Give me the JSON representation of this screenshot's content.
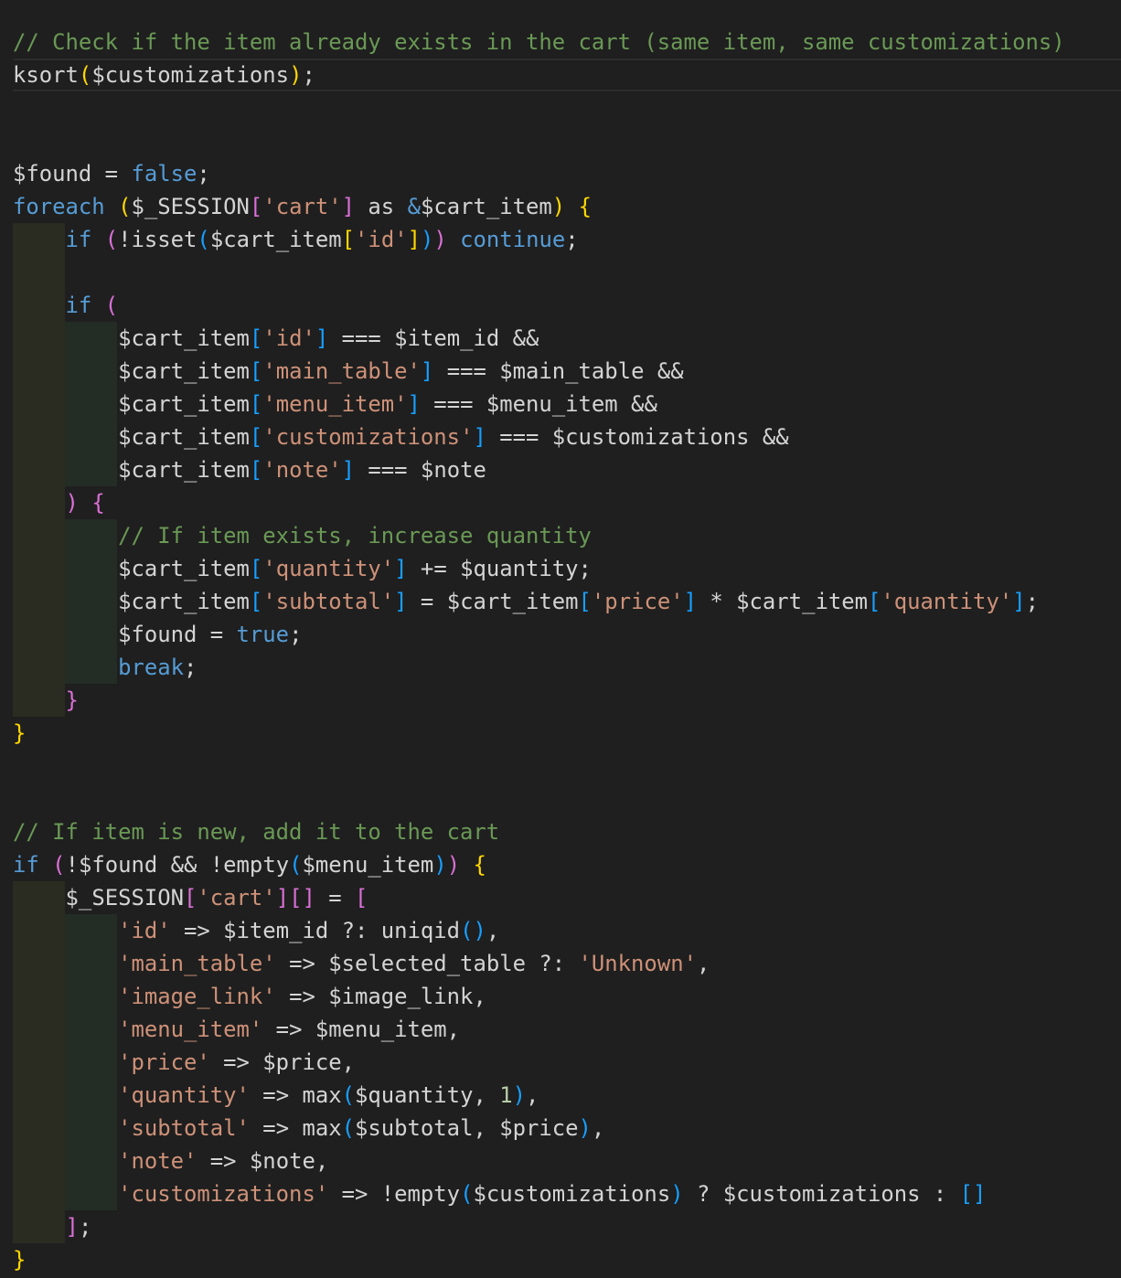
{
  "editor": {
    "language": "php",
    "colors": {
      "background": "#1f1f1f",
      "text": "#d4d4d4",
      "comment": "#6a9955",
      "keyword": "#569cd6",
      "string": "#ce9178",
      "number": "#b5cea8",
      "bracket_level_1": "#ffd700",
      "bracket_level_2": "#da70d6",
      "bracket_level_3": "#179fff"
    },
    "lines": [
      {
        "indent": 0,
        "tokens": [
          [
            "cm",
            "// Check if the item already exists in the cart (same item, same customizations)"
          ]
        ]
      },
      {
        "indent": 0,
        "current": true,
        "tokens": [
          [
            "",
            "ksort"
          ],
          [
            "b1",
            "("
          ],
          [
            "",
            "$customizations"
          ],
          [
            "b1",
            ")"
          ],
          [
            "",
            ";"
          ]
        ]
      },
      {
        "indent": 0,
        "tokens": []
      },
      {
        "indent": 0,
        "tokens": []
      },
      {
        "indent": 0,
        "tokens": [
          [
            "",
            "$found = "
          ],
          [
            "kw",
            "false"
          ],
          [
            "",
            ";"
          ]
        ]
      },
      {
        "indent": 0,
        "tokens": [
          [
            "kw",
            "foreach"
          ],
          [
            "",
            " "
          ],
          [
            "b1",
            "("
          ],
          [
            "",
            "$_SESSION"
          ],
          [
            "b2",
            "["
          ],
          [
            "str",
            "'cart'"
          ],
          [
            "b2",
            "]"
          ],
          [
            "",
            " as "
          ],
          [
            "kw",
            "&"
          ],
          [
            "",
            "$cart_item"
          ],
          [
            "b1",
            ")"
          ],
          [
            "",
            " "
          ],
          [
            "b1",
            "{"
          ]
        ]
      },
      {
        "indent": 1,
        "tokens": [
          [
            "kw",
            "if"
          ],
          [
            "",
            " "
          ],
          [
            "b2",
            "("
          ],
          [
            "",
            "!isset"
          ],
          [
            "b3",
            "("
          ],
          [
            "",
            "$cart_item"
          ],
          [
            "b1",
            "["
          ],
          [
            "str",
            "'id'"
          ],
          [
            "b1",
            "]"
          ],
          [
            "b3",
            ")"
          ],
          [
            "b2",
            ")"
          ],
          [
            "",
            " "
          ],
          [
            "kw",
            "continue"
          ],
          [
            "",
            ";"
          ]
        ]
      },
      {
        "indent": 1,
        "blank_guides": true,
        "tokens": []
      },
      {
        "indent": 1,
        "tokens": [
          [
            "kw",
            "if"
          ],
          [
            "",
            " "
          ],
          [
            "b2",
            "("
          ]
        ]
      },
      {
        "indent": 2,
        "tokens": [
          [
            "",
            "$cart_item"
          ],
          [
            "b3",
            "["
          ],
          [
            "str",
            "'id'"
          ],
          [
            "b3",
            "]"
          ],
          [
            "",
            " === $item_id &&"
          ]
        ]
      },
      {
        "indent": 2,
        "tokens": [
          [
            "",
            "$cart_item"
          ],
          [
            "b3",
            "["
          ],
          [
            "str",
            "'main_table'"
          ],
          [
            "b3",
            "]"
          ],
          [
            "",
            " === $main_table &&"
          ]
        ]
      },
      {
        "indent": 2,
        "tokens": [
          [
            "",
            "$cart_item"
          ],
          [
            "b3",
            "["
          ],
          [
            "str",
            "'menu_item'"
          ],
          [
            "b3",
            "]"
          ],
          [
            "",
            " === $menu_item &&"
          ]
        ]
      },
      {
        "indent": 2,
        "tokens": [
          [
            "",
            "$cart_item"
          ],
          [
            "b3",
            "["
          ],
          [
            "str",
            "'customizations'"
          ],
          [
            "b3",
            "]"
          ],
          [
            "",
            " === $customizations &&"
          ]
        ]
      },
      {
        "indent": 2,
        "tokens": [
          [
            "",
            "$cart_item"
          ],
          [
            "b3",
            "["
          ],
          [
            "str",
            "'note'"
          ],
          [
            "b3",
            "]"
          ],
          [
            "",
            " === $note"
          ]
        ]
      },
      {
        "indent": 1,
        "tokens": [
          [
            "b2",
            ")"
          ],
          [
            "",
            " "
          ],
          [
            "b2",
            "{"
          ]
        ]
      },
      {
        "indent": 2,
        "tokens": [
          [
            "cm",
            "// If item exists, increase quantity"
          ]
        ]
      },
      {
        "indent": 2,
        "tokens": [
          [
            "",
            "$cart_item"
          ],
          [
            "b3",
            "["
          ],
          [
            "str",
            "'quantity'"
          ],
          [
            "b3",
            "]"
          ],
          [
            "",
            " += $quantity;"
          ]
        ]
      },
      {
        "indent": 2,
        "tokens": [
          [
            "",
            "$cart_item"
          ],
          [
            "b3",
            "["
          ],
          [
            "str",
            "'subtotal'"
          ],
          [
            "b3",
            "]"
          ],
          [
            "",
            " = $cart_item"
          ],
          [
            "b3",
            "["
          ],
          [
            "str",
            "'price'"
          ],
          [
            "b3",
            "]"
          ],
          [
            "",
            " * $cart_item"
          ],
          [
            "b3",
            "["
          ],
          [
            "str",
            "'quantity'"
          ],
          [
            "b3",
            "]"
          ],
          [
            "",
            ";"
          ]
        ]
      },
      {
        "indent": 2,
        "tokens": [
          [
            "",
            "$found = "
          ],
          [
            "kw",
            "true"
          ],
          [
            "",
            ";"
          ]
        ]
      },
      {
        "indent": 2,
        "tokens": [
          [
            "kw",
            "break"
          ],
          [
            "",
            ";"
          ]
        ]
      },
      {
        "indent": 1,
        "tokens": [
          [
            "b2",
            "}"
          ]
        ]
      },
      {
        "indent": 0,
        "tokens": [
          [
            "b1",
            "}"
          ]
        ]
      },
      {
        "indent": 0,
        "tokens": []
      },
      {
        "indent": 0,
        "tokens": []
      },
      {
        "indent": 0,
        "tokens": [
          [
            "cm",
            "// If item is new, add it to the cart"
          ]
        ]
      },
      {
        "indent": 0,
        "tokens": [
          [
            "kw",
            "if"
          ],
          [
            "",
            " "
          ],
          [
            "b2",
            "("
          ],
          [
            "",
            "!$found && !empty"
          ],
          [
            "b3",
            "("
          ],
          [
            "",
            "$menu_item"
          ],
          [
            "b3",
            ")"
          ],
          [
            "b2",
            ")"
          ],
          [
            "",
            " "
          ],
          [
            "b1",
            "{"
          ]
        ]
      },
      {
        "indent": 1,
        "tokens": [
          [
            "",
            "$_SESSION"
          ],
          [
            "b2",
            "["
          ],
          [
            "str",
            "'cart'"
          ],
          [
            "b2",
            "]["
          ],
          [
            "b2",
            "]"
          ],
          [
            "",
            " = "
          ],
          [
            "b2",
            "["
          ]
        ]
      },
      {
        "indent": 2,
        "tokens": [
          [
            "str",
            "'id'"
          ],
          [
            "",
            " => $item_id ?: uniqid"
          ],
          [
            "b3",
            "()"
          ],
          [
            "",
            ","
          ]
        ]
      },
      {
        "indent": 2,
        "tokens": [
          [
            "str",
            "'main_table'"
          ],
          [
            "",
            " => $selected_table ?: "
          ],
          [
            "str",
            "'Unknown'"
          ],
          [
            "",
            ","
          ]
        ]
      },
      {
        "indent": 2,
        "tokens": [
          [
            "str",
            "'image_link'"
          ],
          [
            "",
            " => $image_link,"
          ]
        ]
      },
      {
        "indent": 2,
        "tokens": [
          [
            "str",
            "'menu_item'"
          ],
          [
            "",
            " => $menu_item,"
          ]
        ]
      },
      {
        "indent": 2,
        "tokens": [
          [
            "str",
            "'price'"
          ],
          [
            "",
            " => $price,"
          ]
        ]
      },
      {
        "indent": 2,
        "tokens": [
          [
            "str",
            "'quantity'"
          ],
          [
            "",
            " => max"
          ],
          [
            "b3",
            "("
          ],
          [
            "",
            "$quantity, "
          ],
          [
            "num",
            "1"
          ],
          [
            "b3",
            ")"
          ],
          [
            "",
            ","
          ]
        ]
      },
      {
        "indent": 2,
        "tokens": [
          [
            "str",
            "'subtotal'"
          ],
          [
            "",
            " => max"
          ],
          [
            "b3",
            "("
          ],
          [
            "",
            "$subtotal, $price"
          ],
          [
            "b3",
            ")"
          ],
          [
            "",
            ","
          ]
        ]
      },
      {
        "indent": 2,
        "tokens": [
          [
            "str",
            "'note'"
          ],
          [
            "",
            " => $note,"
          ]
        ]
      },
      {
        "indent": 2,
        "tokens": [
          [
            "str",
            "'customizations'"
          ],
          [
            "",
            " => !empty"
          ],
          [
            "b3",
            "("
          ],
          [
            "",
            "$customizations"
          ],
          [
            "b3",
            ")"
          ],
          [
            "",
            " ? $customizations : "
          ],
          [
            "b3",
            "[]"
          ]
        ]
      },
      {
        "indent": 1,
        "tokens": [
          [
            "b2",
            "]"
          ],
          [
            "",
            ";"
          ]
        ]
      },
      {
        "indent": 0,
        "tokens": [
          [
            "b1",
            "}"
          ]
        ]
      }
    ]
  }
}
